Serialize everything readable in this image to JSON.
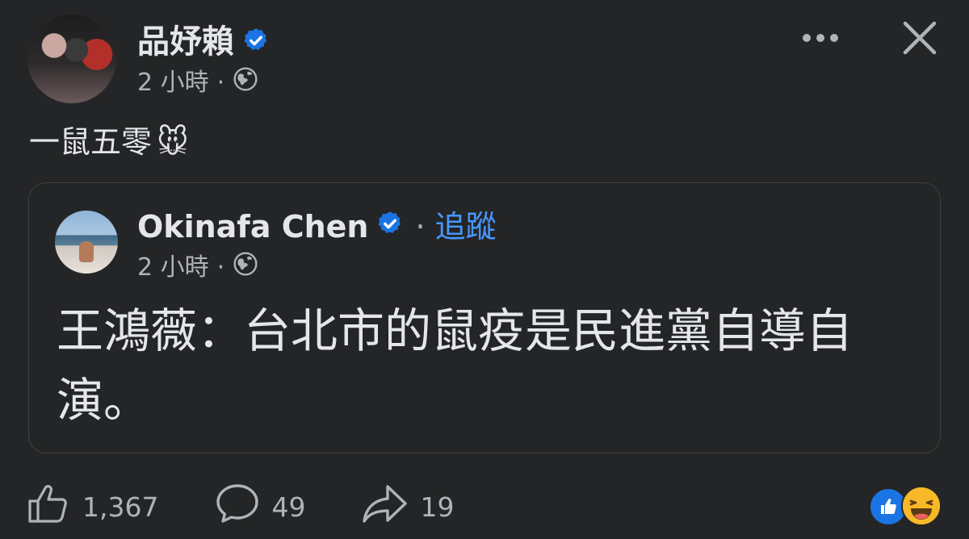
{
  "post": {
    "author": "品妤賴",
    "time": "2 小時",
    "separator": "·",
    "text": "一鼠五零",
    "emoji": "🐭",
    "icons": {
      "verified": "verified-badge-icon",
      "privacy": "globe-icon",
      "more": "more-options-icon",
      "close": "close-icon"
    }
  },
  "shared": {
    "author": "Okinafa Chen",
    "separator": "·",
    "follow_label": "追蹤",
    "time": "2 小時",
    "text": "王鴻薇：台北市的鼠疫是民進黨自導自演。"
  },
  "actions": {
    "likes": "1,367",
    "comments": "49",
    "shares": "19",
    "reactions": [
      "like-icon",
      "haha-icon"
    ]
  },
  "colors": {
    "background": "#242526",
    "text_primary": "#e4e6eb",
    "text_secondary": "#b0b3b8",
    "link": "#4599ff",
    "verified": "#1b74e4"
  }
}
